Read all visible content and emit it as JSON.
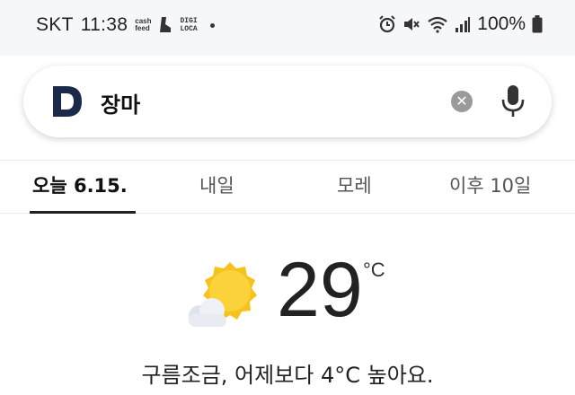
{
  "status_bar": {
    "carrier": "SKT",
    "time": "11:38",
    "app_badge_1": [
      "cash",
      "feed"
    ],
    "app_badge_2": [
      "DIGI",
      "LOCA"
    ],
    "battery": "100%",
    "icons": [
      "alarm-icon",
      "mute-icon",
      "wifi-icon",
      "signal-icon",
      "battery-icon"
    ]
  },
  "search": {
    "query": "장마",
    "logo_letter": "D",
    "brand_color": "#1b2a4a"
  },
  "tabs": [
    {
      "label": "오늘 6.15.",
      "active": true
    },
    {
      "label": "내일",
      "active": false
    },
    {
      "label": "모레",
      "active": false
    },
    {
      "label": "이후 10일",
      "active": false
    }
  ],
  "weather": {
    "icon": "partly-cloudy-icon",
    "temperature": "29",
    "unit": "°C",
    "summary": "구름조금, 어제보다 4°C 높아요.",
    "sun_color": "#f7c21b",
    "cloud_color": "#e8ecf2"
  }
}
